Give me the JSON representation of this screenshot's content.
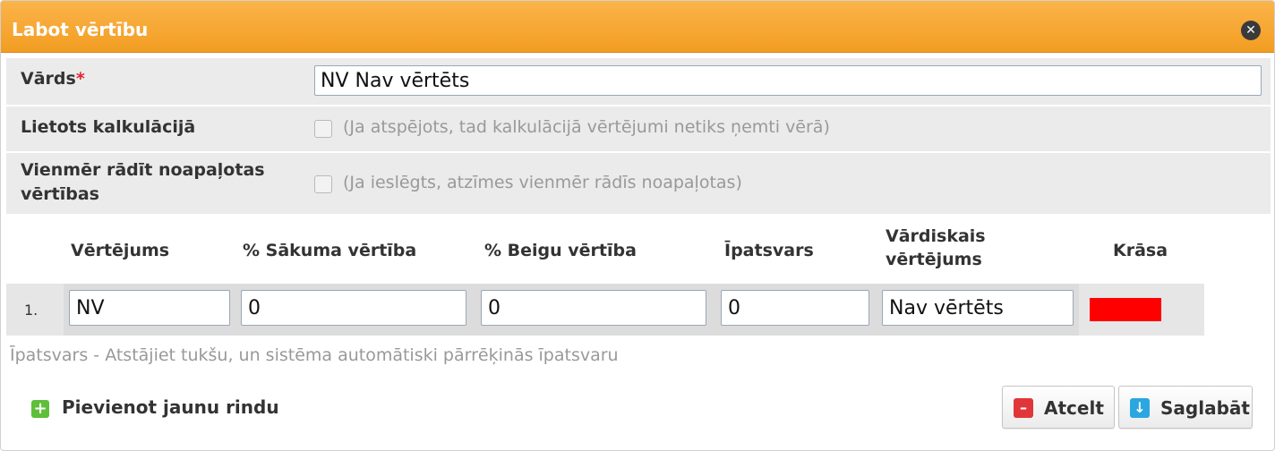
{
  "dialog": {
    "title": "Labot vērtību",
    "close_icon": "close-icon"
  },
  "form": {
    "name_label": "Vārds",
    "name_required": "*",
    "name_value": "NV Nav vērtēts",
    "used_in_calc_label": "Lietots kalkulācijā",
    "used_in_calc_hint": "(Ja atspējots, tad kalkulācijā vērtējumi netiks ņemti vērā)",
    "always_rounded_label_line1": "Vienmēr rādīt noapaļotas",
    "always_rounded_label_line2": "vērtības",
    "always_rounded_hint": "(Ja ieslēgts, atzīmes vienmēr rādīs noapaļotas)"
  },
  "table": {
    "columns": {
      "grade": "Vērtējums",
      "start": "% Sākuma vērtība",
      "end": "% Beigu vērtība",
      "weight": "Īpatsvars",
      "verbal_line1": "Vārdiskais",
      "verbal_line2": "vērtējums",
      "color": "Krāsa"
    },
    "rows": [
      {
        "num": "1.",
        "grade": "NV",
        "start": "0",
        "end": "0",
        "weight": "0",
        "verbal": "Nav vērtēts",
        "color": "#ff0000"
      }
    ],
    "footnote": "Īpatsvars - Atstājiet tukšu, un sistēma automātiski pārrēķinās īpatsvaru"
  },
  "footer": {
    "add_row_label": "Pievienot jaunu rindu",
    "cancel_label": "Atcelt",
    "save_label": "Saglabāt"
  },
  "colors": {
    "titlebar": "#f5a52a",
    "add_icon": "#5fbe3a",
    "cancel_icon": "#e0363a",
    "save_icon": "#2aa7e0"
  }
}
